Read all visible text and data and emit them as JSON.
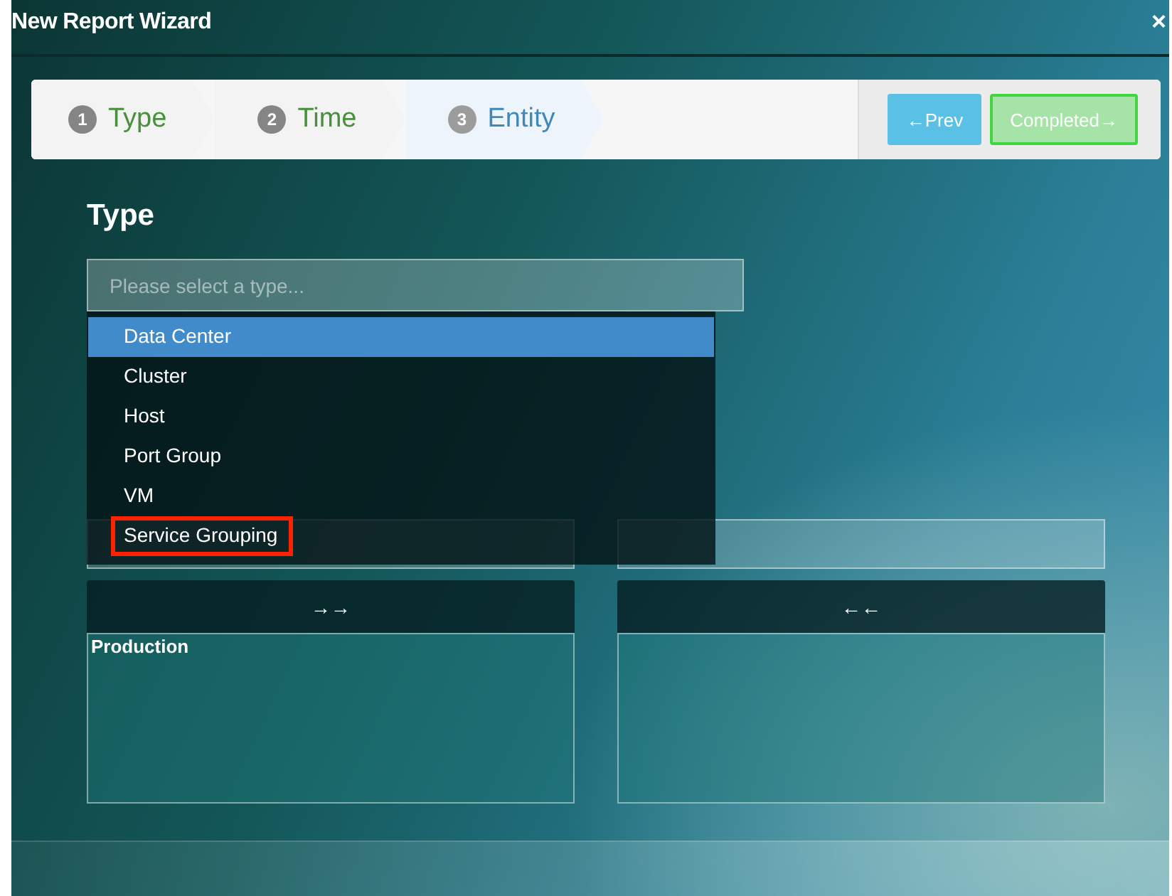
{
  "window": {
    "title": "New Report Wizard",
    "close": "×"
  },
  "steps": [
    {
      "number": "1",
      "label": "Type",
      "completed": true,
      "selected": false
    },
    {
      "number": "2",
      "label": "Time",
      "completed": true,
      "selected": false
    },
    {
      "number": "3",
      "label": "Entity",
      "completed": false,
      "selected": true
    }
  ],
  "nav_buttons": [
    {
      "label": "←Prev",
      "kind": "prev"
    },
    {
      "label": "Completed→",
      "kind": "complete"
    }
  ],
  "type_section": {
    "heading": "Type",
    "placeholder": "Please select a type...",
    "options": [
      {
        "label": "Data Center",
        "selected": true,
        "highlighted": false
      },
      {
        "label": "Cluster",
        "selected": false,
        "highlighted": false
      },
      {
        "label": "Host",
        "selected": false,
        "highlighted": false
      },
      {
        "label": "Port Group",
        "selected": false,
        "highlighted": false
      },
      {
        "label": "VM",
        "selected": false,
        "highlighted": false
      },
      {
        "label": "Service Grouping",
        "selected": false,
        "highlighted": true
      }
    ]
  },
  "name_section": {
    "columns": [
      {
        "move_button": "→→",
        "items": [
          "Production"
        ]
      },
      {
        "move_button": "←←"
      }
    ]
  }
}
